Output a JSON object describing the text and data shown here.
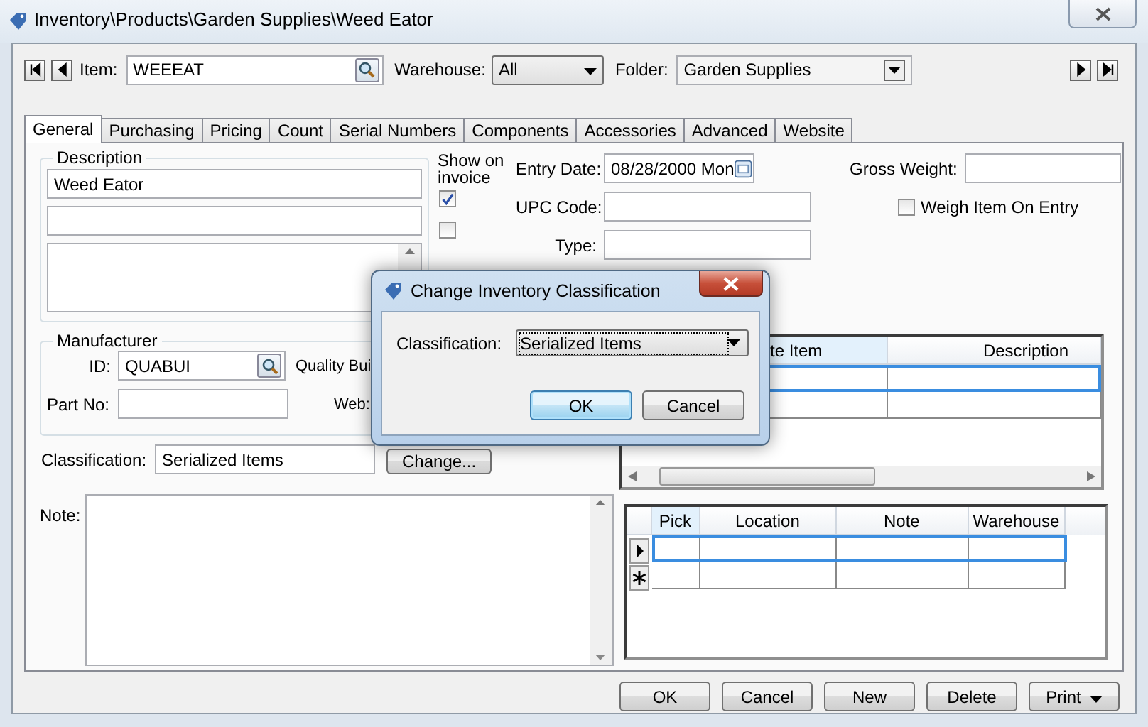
{
  "window": {
    "title": "Inventory\\Products\\Garden Supplies\\Weed Eator"
  },
  "nav": {
    "item_label": "Item:",
    "item": "WEEEAT",
    "warehouse_label": "Warehouse:",
    "warehouse": "All",
    "folder_label": "Folder:",
    "folder": "Garden Supplies"
  },
  "tabs": [
    {
      "label": "General",
      "selected": true
    },
    {
      "label": "Purchasing",
      "selected": false
    },
    {
      "label": "Pricing",
      "selected": false
    },
    {
      "label": "Count",
      "selected": false
    },
    {
      "label": "Serial Numbers",
      "selected": false
    },
    {
      "label": "Components",
      "selected": false
    },
    {
      "label": "Accessories",
      "selected": false
    },
    {
      "label": "Advanced",
      "selected": false
    },
    {
      "label": "Website",
      "selected": false
    }
  ],
  "general": {
    "description": {
      "title": "Description",
      "line_1": "Weed Eator"
    },
    "show_on_invoice": {
      "label": "Show on invoice",
      "checks": [
        {
          "checked": true
        },
        {
          "checked": false
        }
      ]
    },
    "manufacturer": {
      "title": "Manufacturer",
      "id_label": "ID:",
      "id": "QUABUI",
      "name": "Quality Bui",
      "part_label": "Part No:",
      "web_label": "Web:"
    },
    "classification": {
      "label": "Classification:",
      "value": "Serialized Items",
      "button": "Change..."
    },
    "note_label": "Note:",
    "entry_date_label": "Entry Date:",
    "entry_date": "08/28/2000 Mon",
    "upc_label": "UPC Code:",
    "type_label": "Type:",
    "gross_weight_label": "Gross Weight:",
    "weigh_item": {
      "label": "Weigh Item On Entry",
      "checked": false
    }
  },
  "items_grid": {
    "columns": [
      "te Item",
      "Description"
    ]
  },
  "locations_grid": {
    "columns": [
      "Pick",
      "Location",
      "Note",
      "Warehouse"
    ]
  },
  "buttons": [
    "OK",
    "Cancel",
    "New",
    "Delete",
    "Print"
  ],
  "dialog": {
    "title": "Change Inventory Classification",
    "label": "Classification:",
    "value": "Serialized Items",
    "buttons": [
      {
        "label": "OK",
        "default": true
      },
      {
        "label": "Cancel",
        "default": false
      }
    ]
  }
}
